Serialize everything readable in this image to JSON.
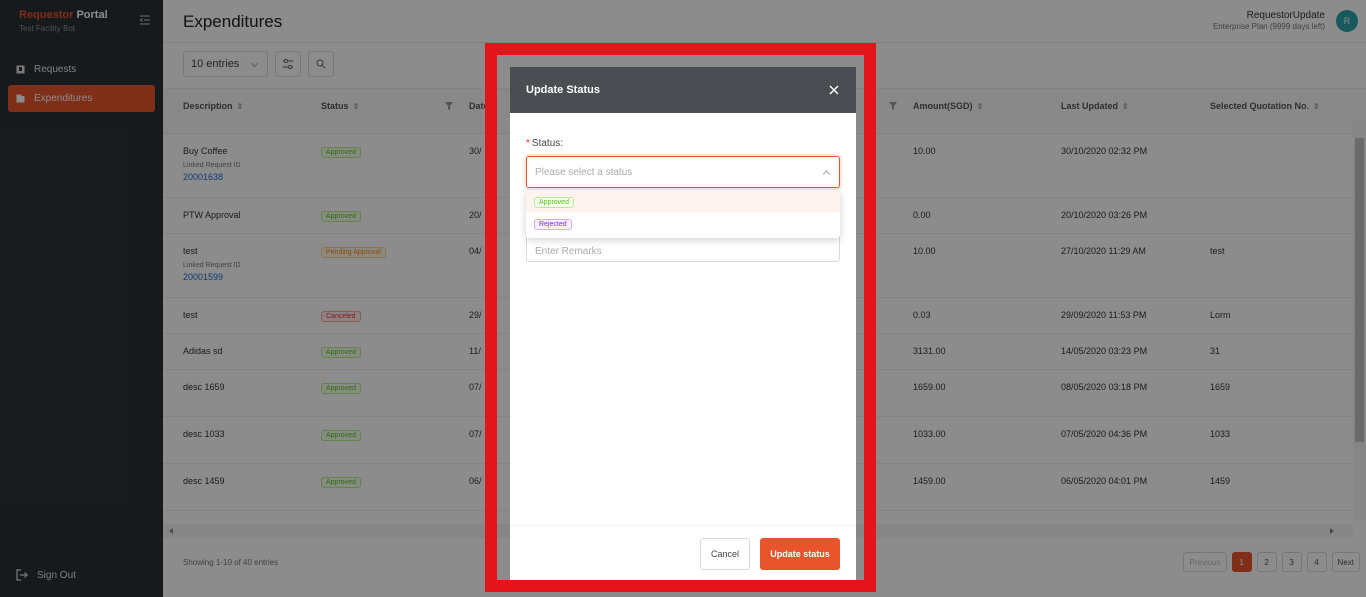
{
  "sidebar": {
    "brand_red": "Requestor",
    "brand_white": "Portal",
    "brand_sub": "Test Facility Bot",
    "items": [
      {
        "label": "Requests"
      },
      {
        "label": "Expenditures"
      }
    ],
    "signout": "Sign Out"
  },
  "header": {
    "title": "Expenditures",
    "user_name": "RequestorUpdate",
    "user_plan": "Enterprise Plan (9999 days left)",
    "avatar": "R"
  },
  "toolbar": {
    "entries": "10 entries"
  },
  "table": {
    "columns": [
      "Description",
      "Status",
      "Date",
      "Amount(SGD)",
      "Last Updated",
      "Selected Quotation No."
    ],
    "linked_label": "Linked Request ID",
    "rows": [
      {
        "description": "Buy Coffee",
        "status": "Approved",
        "date": "30/",
        "amount": "10.00",
        "last_updated": "30/10/2020 02:32 PM",
        "quotation": "",
        "linked_id": "20001638"
      },
      {
        "description": "PTW Approval",
        "status": "Approved",
        "date": "20/",
        "amount": "0.00",
        "last_updated": "20/10/2020 03:26 PM",
        "quotation": "",
        "linked_id": ""
      },
      {
        "description": "test",
        "status": "Pending Approval",
        "date": "04/",
        "amount": "10.00",
        "last_updated": "27/10/2020 11:29 AM",
        "quotation": "test",
        "linked_id": "20001599"
      },
      {
        "description": "test",
        "status": "Canceled",
        "date": "29/",
        "amount": "0.03",
        "last_updated": "29/09/2020 11:53 PM",
        "quotation": "Lorm",
        "linked_id": ""
      },
      {
        "description": "Adidas sd",
        "status": "Approved",
        "date": "11/",
        "amount": "3131.00",
        "last_updated": "14/05/2020 03:23 PM",
        "quotation": "31",
        "linked_id": ""
      },
      {
        "description": "desc 1659",
        "status": "Approved",
        "date": "07/",
        "amount": "1659.00",
        "last_updated": "08/05/2020 03:18 PM",
        "quotation": "1659",
        "linked_id": ""
      },
      {
        "description": "desc 1033",
        "status": "Approved",
        "date": "07/",
        "amount": "1033.00",
        "last_updated": "07/05/2020 04:36 PM",
        "quotation": "1033",
        "linked_id": ""
      },
      {
        "description": "desc 1459",
        "status": "Approved",
        "date": "06/",
        "amount": "1459.00",
        "last_updated": "06/05/2020 04:01 PM",
        "quotation": "1459",
        "linked_id": ""
      }
    ]
  },
  "footer": {
    "info": "Showing 1-10 of 40 entries",
    "pages": [
      "Previous",
      "1",
      "2",
      "3",
      "4",
      "Next"
    ]
  },
  "modal": {
    "title": "Update Status",
    "status_label": "Status",
    "status_placeholder": "Please select a status",
    "options": [
      "Approved",
      "Rejected"
    ],
    "remarks_placeholder": "Enter Remarks",
    "cancel": "Cancel",
    "update": "Update status"
  }
}
